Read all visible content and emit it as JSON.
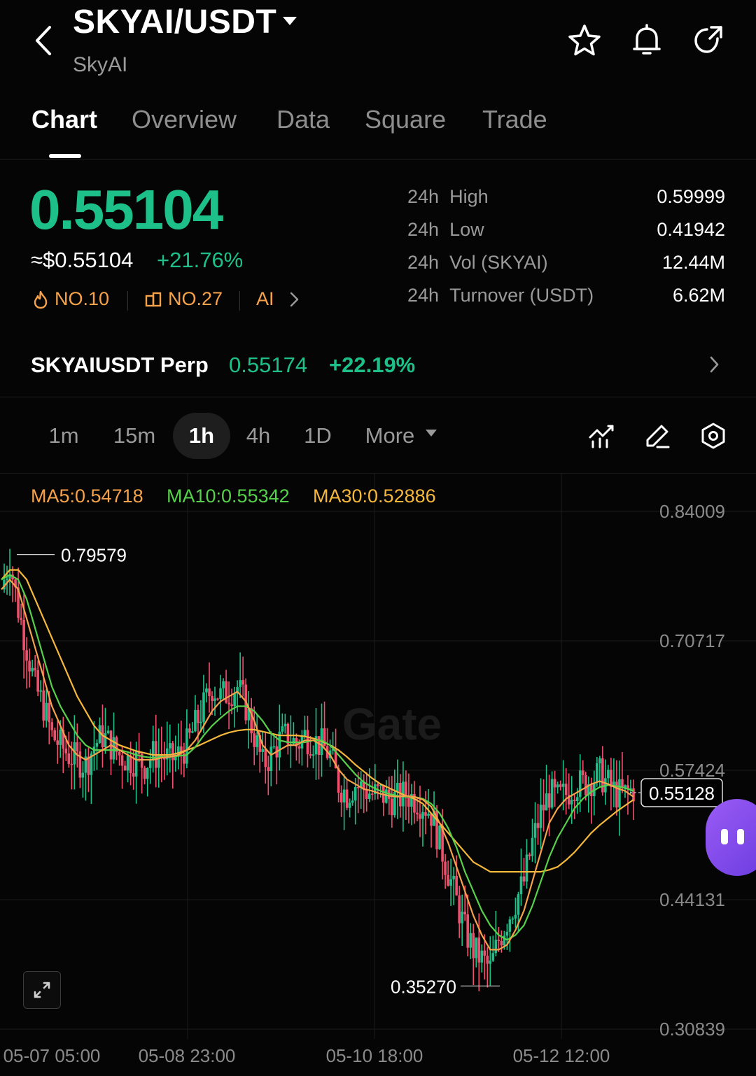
{
  "header": {
    "pair": "SKYAI/USDT",
    "name": "SkyAI",
    "icons": [
      "back-icon",
      "caret-down-icon",
      "star-icon",
      "bell-icon",
      "share-icon"
    ]
  },
  "tabs": [
    {
      "label": "Chart",
      "active": true
    },
    {
      "label": "Overview",
      "active": false
    },
    {
      "label": "Data",
      "active": false
    },
    {
      "label": "Square",
      "active": false
    },
    {
      "label": "Trade",
      "active": false
    }
  ],
  "ticker": {
    "price": "0.55104",
    "usd_price": "≈$0.55104",
    "change": "+21.76%",
    "rank1": "NO.10",
    "rank2": "NO.27",
    "tag": "AI",
    "up_color": "#1ec08a",
    "down_color": "#f0506e"
  },
  "stats": [
    {
      "prefix": "24h",
      "label": "High",
      "value": "0.59999"
    },
    {
      "prefix": "24h",
      "label": "Low",
      "value": "0.41942"
    },
    {
      "prefix": "24h",
      "label": "Vol (SKYAI)",
      "value": "12.44M"
    },
    {
      "prefix": "24h",
      "label": "Turnover (USDT)",
      "value": "6.62M"
    }
  ],
  "perp": {
    "name": "SKYAIUSDT Perp",
    "price": "0.55174",
    "change": "+22.19%"
  },
  "intervals": [
    {
      "label": "1m",
      "active": false
    },
    {
      "label": "15m",
      "active": false
    },
    {
      "label": "1h",
      "active": true
    },
    {
      "label": "4h",
      "active": false
    },
    {
      "label": "1D",
      "active": false
    }
  ],
  "more_label": "More",
  "chart_tools": [
    "indicator-icon",
    "draw-icon",
    "settings-icon"
  ],
  "ma": {
    "ma5": "MA5:0.54718",
    "ma10": "MA10:0.55342",
    "ma30": "MA30:0.52886",
    "ma5_color": "#f5a24a",
    "ma10_color": "#57d04b",
    "ma30_color": "#f5b83a"
  },
  "watermark": "Gate",
  "chart_data": {
    "type": "candlestick",
    "y_ticks": [
      "0.84009",
      "0.70717",
      "0.57424",
      "0.44131",
      "0.30839"
    ],
    "x_ticks": [
      "05-07 05:00",
      "05-08 23:00",
      "05-10 18:00",
      "05-12 12:00"
    ],
    "ylim": [
      0.30839,
      0.84009
    ],
    "high_marker": "0.79579",
    "low_marker": "0.35270",
    "last_price": "0.55128",
    "close_path": [
      0.76,
      0.79,
      0.74,
      0.7,
      0.66,
      0.64,
      0.61,
      0.6,
      0.59,
      0.585,
      0.58,
      0.6,
      0.61,
      0.6,
      0.59,
      0.585,
      0.585,
      0.58,
      0.59,
      0.59,
      0.585,
      0.59,
      0.6,
      0.62,
      0.64,
      0.66,
      0.65,
      0.655,
      0.66,
      0.64,
      0.61,
      0.58,
      0.59,
      0.605,
      0.61,
      0.6,
      0.61,
      0.605,
      0.6,
      0.59,
      0.56,
      0.55,
      0.56,
      0.555,
      0.55,
      0.55,
      0.545,
      0.545,
      0.55,
      0.545,
      0.54,
      0.53,
      0.5,
      0.47,
      0.44,
      0.41,
      0.39,
      0.38,
      0.37,
      0.4,
      0.42,
      0.44,
      0.46,
      0.5,
      0.53,
      0.55,
      0.545,
      0.55,
      0.56,
      0.56,
      0.565,
      0.57,
      0.56,
      0.55,
      0.55,
      0.555
    ],
    "ma5": [
      0.76,
      0.77,
      0.76,
      0.73,
      0.7,
      0.67,
      0.64,
      0.62,
      0.6,
      0.59,
      0.585,
      0.59,
      0.595,
      0.6,
      0.595,
      0.59,
      0.585,
      0.585,
      0.585,
      0.587,
      0.588,
      0.59,
      0.595,
      0.605,
      0.62,
      0.635,
      0.645,
      0.65,
      0.655,
      0.645,
      0.625,
      0.6,
      0.59,
      0.595,
      0.6,
      0.6,
      0.605,
      0.605,
      0.6,
      0.59,
      0.575,
      0.565,
      0.56,
      0.555,
      0.553,
      0.55,
      0.548,
      0.547,
      0.548,
      0.547,
      0.544,
      0.537,
      0.52,
      0.5,
      0.475,
      0.45,
      0.425,
      0.405,
      0.39,
      0.39,
      0.395,
      0.41,
      0.43,
      0.46,
      0.49,
      0.52,
      0.535,
      0.545,
      0.55,
      0.555,
      0.56,
      0.563,
      0.56,
      0.556,
      0.553,
      0.547
    ],
    "ma10": [
      0.77,
      0.775,
      0.77,
      0.75,
      0.72,
      0.69,
      0.66,
      0.64,
      0.625,
      0.61,
      0.6,
      0.595,
      0.595,
      0.595,
      0.595,
      0.593,
      0.59,
      0.588,
      0.587,
      0.588,
      0.588,
      0.589,
      0.59,
      0.598,
      0.61,
      0.62,
      0.628,
      0.635,
      0.64,
      0.64,
      0.635,
      0.625,
      0.612,
      0.605,
      0.603,
      0.603,
      0.603,
      0.605,
      0.605,
      0.6,
      0.59,
      0.58,
      0.57,
      0.562,
      0.557,
      0.553,
      0.55,
      0.548,
      0.547,
      0.547,
      0.545,
      0.54,
      0.53,
      0.515,
      0.495,
      0.47,
      0.45,
      0.43,
      0.415,
      0.405,
      0.4,
      0.405,
      0.415,
      0.435,
      0.46,
      0.485,
      0.505,
      0.52,
      0.535,
      0.545,
      0.552,
      0.557,
      0.559,
      0.558,
      0.556,
      0.553
    ],
    "ma30": [
      0.77,
      0.78,
      0.78,
      0.77,
      0.75,
      0.73,
      0.71,
      0.69,
      0.67,
      0.65,
      0.635,
      0.62,
      0.61,
      0.605,
      0.6,
      0.597,
      0.594,
      0.592,
      0.59,
      0.59,
      0.59,
      0.592,
      0.595,
      0.598,
      0.602,
      0.606,
      0.61,
      0.613,
      0.615,
      0.616,
      0.616,
      0.614,
      0.612,
      0.61,
      0.61,
      0.61,
      0.609,
      0.607,
      0.604,
      0.6,
      0.595,
      0.588,
      0.58,
      0.573,
      0.566,
      0.56,
      0.556,
      0.552,
      0.548,
      0.545,
      0.54,
      0.53,
      0.52,
      0.51,
      0.5,
      0.49,
      0.48,
      0.475,
      0.47,
      0.47,
      0.47,
      0.47,
      0.47,
      0.47,
      0.47,
      0.472,
      0.475,
      0.482,
      0.49,
      0.5,
      0.51,
      0.518,
      0.525,
      0.532,
      0.538,
      0.544
    ]
  }
}
